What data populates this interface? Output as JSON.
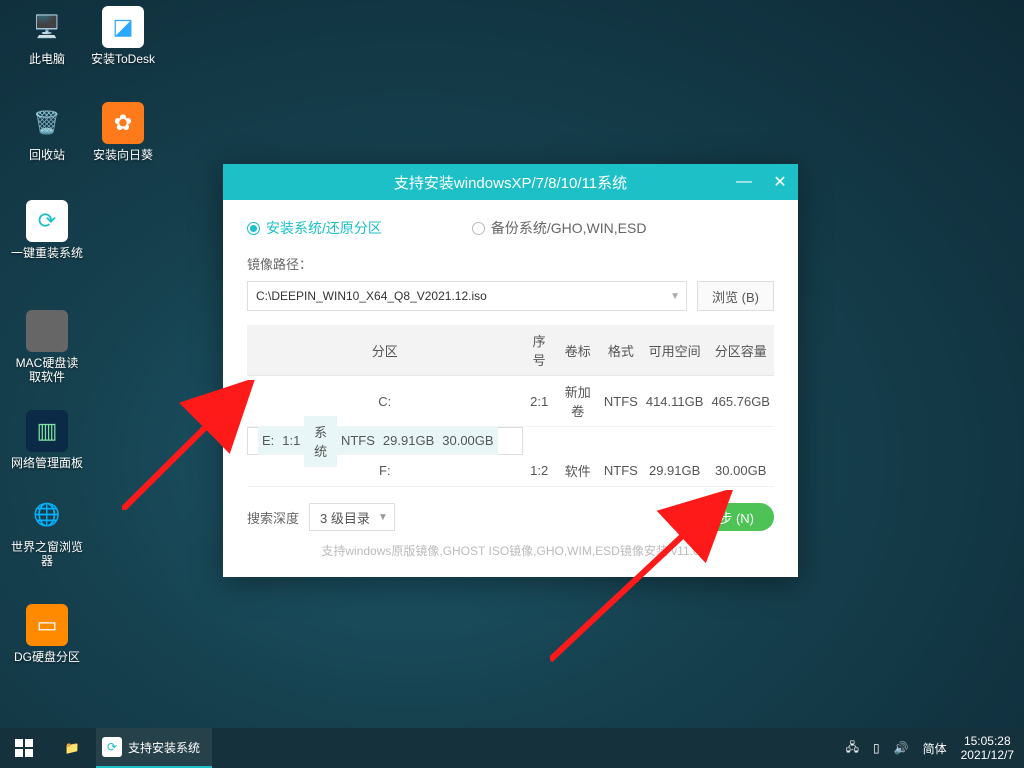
{
  "desktop_icons": [
    {
      "label": "此电脑",
      "bg": "transparent",
      "glyph": "💻"
    },
    {
      "label": "安装ToDesk",
      "bg": "#fff",
      "glyph": "🟦"
    },
    {
      "label": "回收站",
      "bg": "transparent",
      "glyph": "🗑"
    },
    {
      "label": "安装向日葵",
      "bg": "#ff7a1a",
      "glyph": "✿"
    },
    {
      "label": "一键重装系统",
      "bg": "#fff",
      "glyph": "↺"
    },
    {
      "label": "MAC硬盘读取软件",
      "bg": "#555",
      "glyph": ""
    },
    {
      "label": "网络管理面板",
      "bg": "#0a2a46",
      "glyph": "📊"
    },
    {
      "label": "世界之窗浏览器",
      "bg": "transparent",
      "glyph": "🌐"
    },
    {
      "label": "DG硬盘分区",
      "bg": "#ff8a00",
      "glyph": "▭"
    }
  ],
  "window": {
    "title": "支持安装windowsXP/7/8/10/11系统",
    "radio_install": "安装系统/还原分区",
    "radio_backup": "备份系统/GHO,WIN,ESD",
    "path_label": "镜像路径：",
    "path_value": "C:\\DEEPIN_WIN10_X64_Q8_V2021.12.iso",
    "browse": "浏览 (B)",
    "headers": [
      "分区",
      "序号",
      "卷标",
      "格式",
      "可用空间",
      "分区容量"
    ],
    "rows": [
      {
        "p": "C:",
        "n": "2:1",
        "v": "新加卷",
        "f": "NTFS",
        "free": "414.11GB",
        "cap": "465.76GB",
        "sel": false
      },
      {
        "p": "E:",
        "n": "1:1",
        "v": "系统",
        "f": "NTFS",
        "free": "29.91GB",
        "cap": "30.00GB",
        "sel": true
      },
      {
        "p": "F:",
        "n": "1:2",
        "v": "软件",
        "f": "NTFS",
        "free": "29.91GB",
        "cap": "30.00GB",
        "sel": false
      }
    ],
    "depth_label": "搜索深度",
    "depth_value": "3 级目录",
    "next": "下一步 (N)",
    "hint": "支持windows原版镜像,GHOST ISO镜像,GHO,WIM,ESD镜像安装   v11.0"
  },
  "taskbar": {
    "task_label": "支持安装系统",
    "ime": "简体",
    "time": "15:05:28",
    "date": "2021/12/7"
  }
}
